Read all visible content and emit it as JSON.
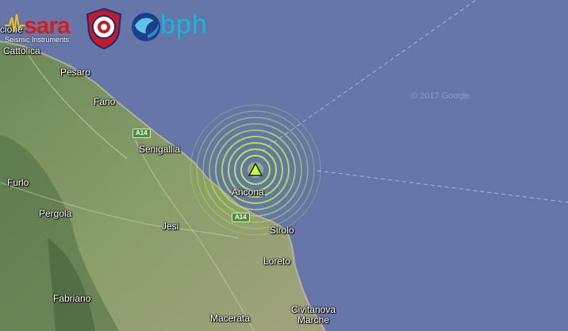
{
  "logos": {
    "sara_name": "sara",
    "sara_subtitle": "Seismic Instruments",
    "bph_name": "bph"
  },
  "map": {
    "copyright": "© 2017 Google",
    "cities": [
      {
        "name": "Cattolica",
        "key": "cattolica"
      },
      {
        "name": "Pesaro",
        "key": "pesaro"
      },
      {
        "name": "Fano",
        "key": "fano"
      },
      {
        "name": "Senigallia",
        "key": "senigallia"
      },
      {
        "name": "Ancona",
        "key": "ancona"
      },
      {
        "name": "Jesi",
        "key": "jesi"
      },
      {
        "name": "Sirolo",
        "key": "sirolo"
      },
      {
        "name": "Loreto",
        "key": "loreto"
      },
      {
        "name": "Pergola",
        "key": "pergola"
      },
      {
        "name": "Furlo",
        "key": "furlo"
      },
      {
        "name": "Fabriano",
        "key": "fabriano"
      },
      {
        "name": "Macerata",
        "key": "macerata"
      },
      {
        "name": "Civitanova Marche",
        "key": "civitanova"
      },
      {
        "name": "cione",
        "key": "cione"
      }
    ],
    "road_shields": [
      "A14",
      "A14"
    ],
    "colors": {
      "sea": "#6676a8",
      "ring": "#b6f03a",
      "land": "#7f9a5f"
    },
    "epicenter": {
      "icon": "warning-triangle-icon",
      "rings": 10
    }
  }
}
